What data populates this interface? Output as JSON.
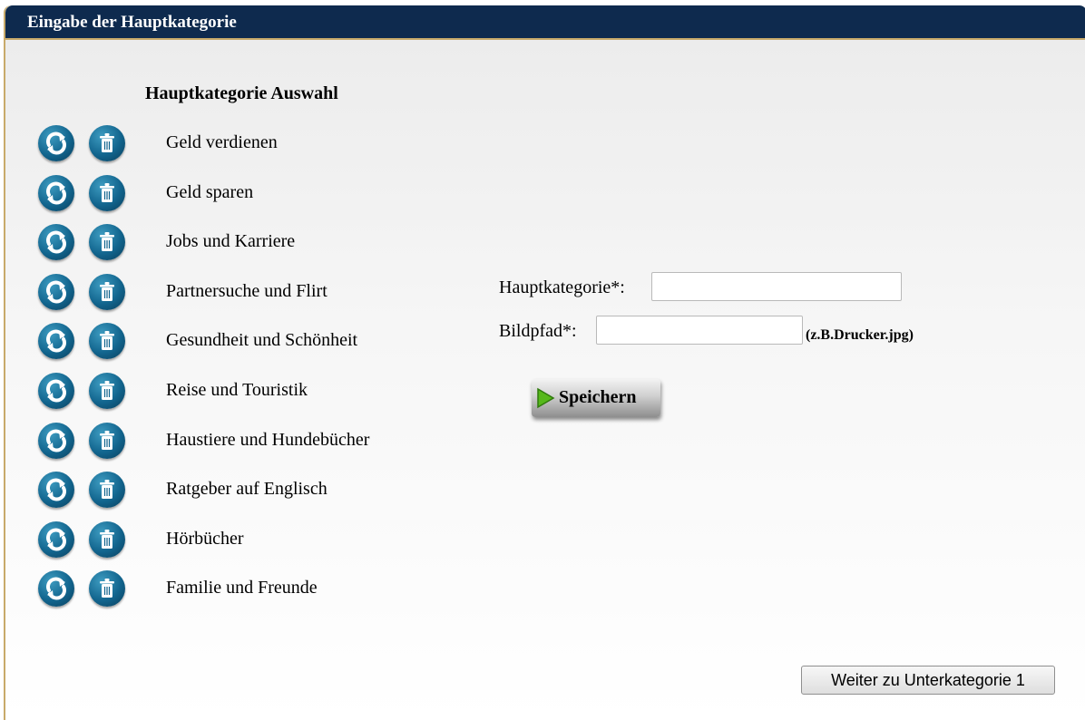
{
  "window": {
    "title": "Eingabe der Hauptkategorie"
  },
  "list": {
    "heading": "Hauptkategorie Auswahl",
    "edit_icon": "refresh-icon",
    "delete_icon": "trash-icon",
    "items": [
      {
        "label": "Geld verdienen"
      },
      {
        "label": "Geld sparen"
      },
      {
        "label": "Jobs und Karriere"
      },
      {
        "label": "Partnersuche und Flirt"
      },
      {
        "label": "Gesundheit und Schönheit"
      },
      {
        "label": "Reise und Touristik"
      },
      {
        "label": "Haustiere und Hundebücher"
      },
      {
        "label": "Ratgeber auf Englisch"
      },
      {
        "label": "Hörbücher"
      },
      {
        "label": "Familie und Freunde"
      }
    ]
  },
  "form": {
    "category_label": "Hauptkategorie*:",
    "category_value": "",
    "image_label": "Bildpfad*:",
    "image_value": "",
    "image_hint": "(z.B.Drucker.jpg)",
    "save_label": "Speichern",
    "save_icon": "play-arrow-icon"
  },
  "footer": {
    "next_label": "Weiter zu Unterkategorie 1"
  },
  "colors": {
    "titlebar": "#0e2a4e",
    "border_gold": "#c8aa6a",
    "icon_blue": "#12658e",
    "play_green": "#56b81a"
  }
}
